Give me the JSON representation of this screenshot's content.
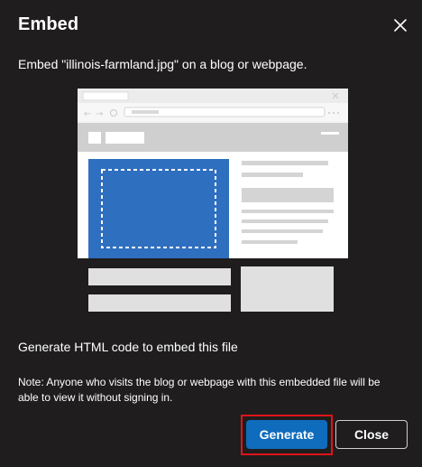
{
  "dialog": {
    "title": "Embed",
    "subtitle": "Embed \"illinois-farmland.jpg\" on a blog or webpage.",
    "generate_heading": "Generate HTML code to embed this file",
    "note": "Note: Anyone who visits the blog or webpage with this embedded file will be able to view it without signing in.",
    "buttons": {
      "generate_label": "Generate",
      "close_label": "Close"
    },
    "icons": {
      "close": "close-icon",
      "illustration": "embed-webpage-illustration"
    },
    "colors": {
      "background": "#1f1d1d",
      "primary": "#0f6cbd",
      "highlight_outline": "#e0131a",
      "illustration_accent": "#2f6fbf"
    }
  }
}
